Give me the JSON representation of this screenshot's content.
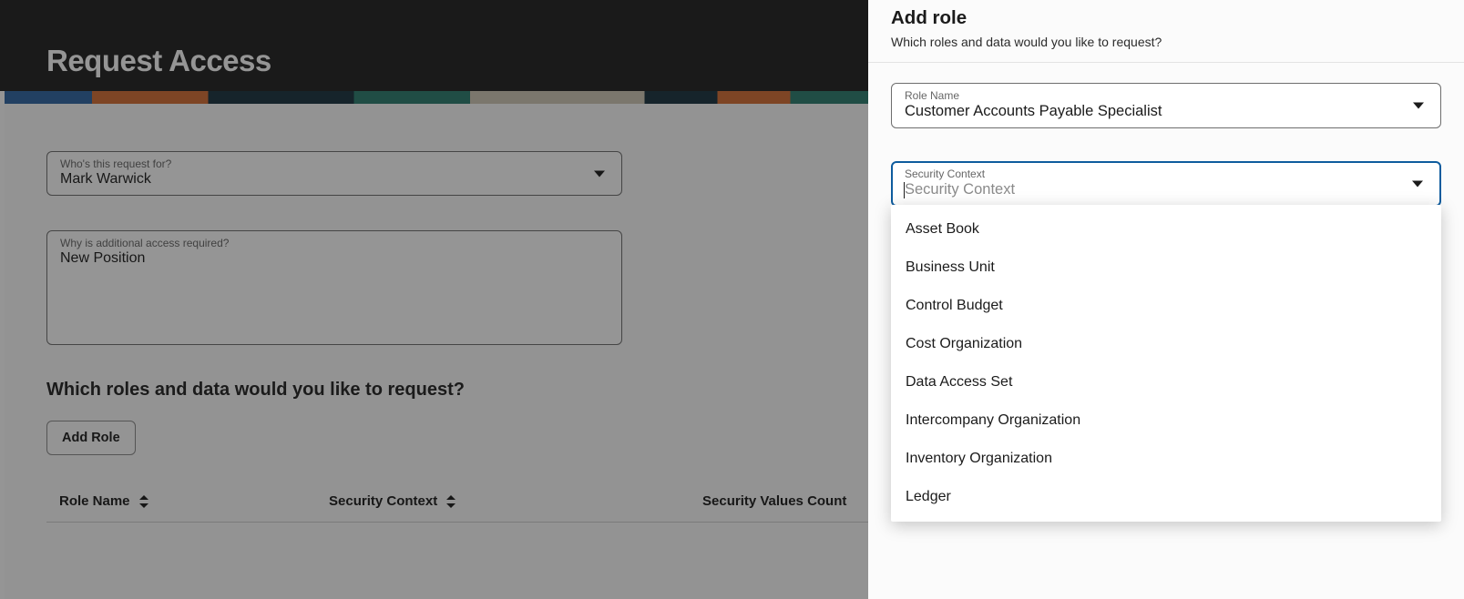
{
  "page": {
    "title": "Request Access"
  },
  "form": {
    "for_label": "Who's this request for?",
    "for_value": "Mark Warwick",
    "reason_label": "Why is additional access required?",
    "reason_value": "New Position",
    "section_heading": "Which roles and data would you like to request?",
    "add_role_button": "Add Role"
  },
  "table": {
    "cols": [
      "Role Name",
      "Security Context",
      "Security Values Count"
    ]
  },
  "drawer": {
    "title": "Add role",
    "subtitle": "Which roles and data would you like to request?",
    "role_label": "Role Name",
    "role_value": "Customer Accounts Payable Specialist",
    "ctx_label": "Security Context",
    "ctx_placeholder": "Security Context",
    "options": [
      "Asset Book",
      "Business Unit",
      "Control Budget",
      "Cost Organization",
      "Data Access Set",
      "Intercompany Organization",
      "Inventory Organization",
      "Ledger"
    ]
  }
}
